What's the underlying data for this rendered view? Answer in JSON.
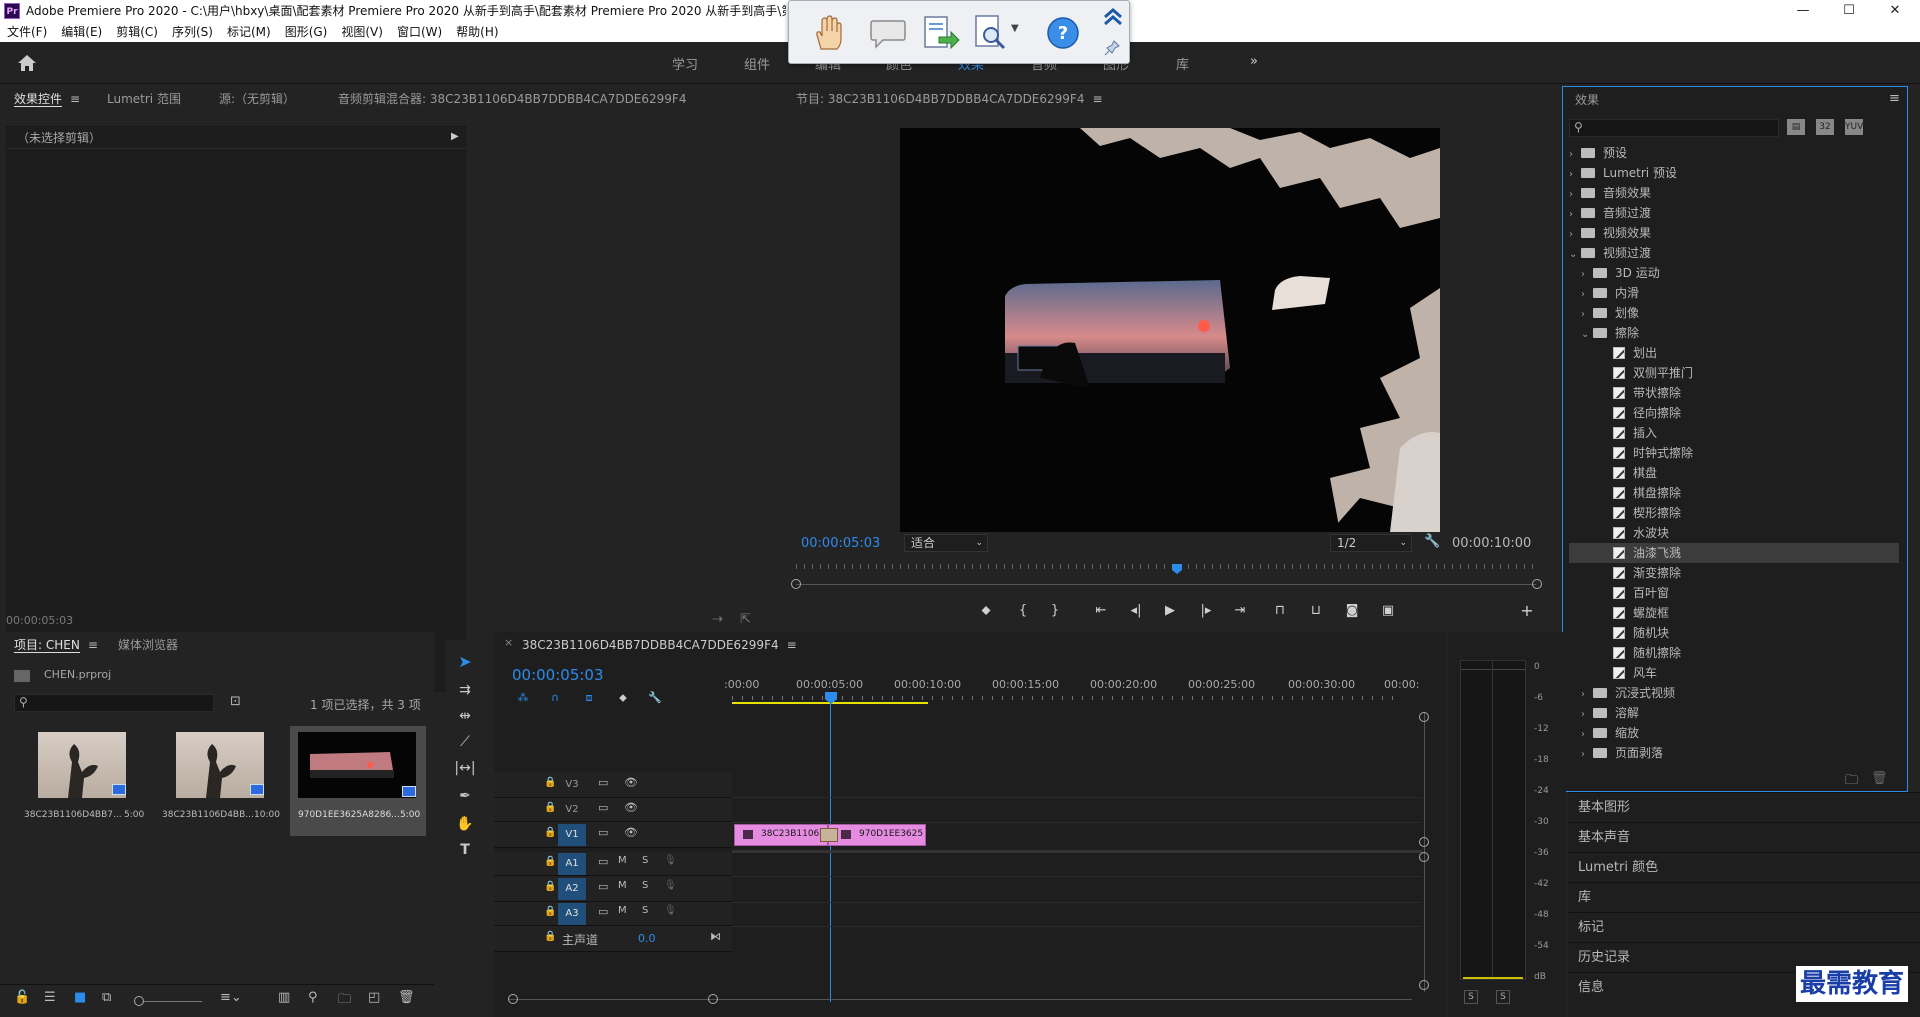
{
  "app": {
    "title": "Adobe Premiere Pro 2020 - C:\\用户\\hbxy\\桌面\\配套素材 Premiere Pro 2020 从新手到高手\\配套素材 Premiere Pro 2020 从新手到高手\\第",
    "icon": "Pr"
  },
  "window_controls": {
    "minimize": "—",
    "maximize": "☐",
    "close": "✕"
  },
  "menu": [
    "文件(F)",
    "编辑(E)",
    "剪辑(C)",
    "序列(S)",
    "标记(M)",
    "图形(G)",
    "视图(V)",
    "窗口(W)",
    "帮助(H)"
  ],
  "workspace_tabs": [
    "学习",
    "组件",
    "编辑",
    "颜色",
    "效果",
    "音频",
    "图形",
    "库"
  ],
  "workspace_more": "»",
  "top_left_tabs": {
    "effect_controls": "效果控件",
    "lumetri_scopes": "Lumetri 范围",
    "source": "源:（无剪辑）",
    "audio_mixer": "音频剪辑混合器: 38C23B1106D4BB7DDBB4CA7DDE6299F4"
  },
  "effect_controls": {
    "no_clip": "（未选择剪辑）",
    "timecode": "00:00:05:03"
  },
  "program": {
    "title": "节目: 38C23B1106D4BB7DDBB4CA7DDE6299F4",
    "timecode": "00:00:05:03",
    "fit": "适合",
    "resolution": "1/2",
    "duration": "00:00:10:00"
  },
  "project": {
    "tab": "项目: CHEN",
    "media_tab": "媒体浏览器",
    "file": "CHEN.prproj",
    "selection": "1 项已选择，共 3 项",
    "items": [
      {
        "name": "38C23B1106D4BB7...",
        "dur": "5:00"
      },
      {
        "name": "38C23B1106D4BB...",
        "dur": "10:00"
      },
      {
        "name": "970D1EE3625A8286...",
        "dur": "5:00"
      }
    ]
  },
  "timeline": {
    "tab": "38C23B1106D4BB7DDBB4CA7DDE6299F4",
    "timecode": "00:00:05:03",
    "ruler": [
      ":00:00",
      "00:00:05:00",
      "00:00:10:00",
      "00:00:15:00",
      "00:00:20:00",
      "00:00:25:00",
      "00:00:30:00",
      "00:00:"
    ],
    "video_tracks": [
      "V3",
      "V2",
      "V1"
    ],
    "audio_tracks": [
      "A1",
      "A2",
      "A3"
    ],
    "mute": "M",
    "solo": "S",
    "master": {
      "label": "主声道",
      "value": "0.0"
    },
    "clips": [
      "38C23B1106",
      "970D1EE3625"
    ]
  },
  "meter": {
    "labels": [
      "0",
      "-6",
      "-12",
      "-18",
      "-24",
      "-30",
      "-36",
      "-42",
      "-48",
      "-54",
      "dB"
    ],
    "solo": [
      "S",
      "S"
    ]
  },
  "effects": {
    "title": "效果",
    "tree": [
      {
        "label": "预设",
        "level": 0,
        "type": "folder",
        "open": false
      },
      {
        "label": "Lumetri 预设",
        "level": 0,
        "type": "folder",
        "open": false
      },
      {
        "label": "音频效果",
        "level": 0,
        "type": "folder",
        "open": false
      },
      {
        "label": "音频过渡",
        "level": 0,
        "type": "folder",
        "open": false
      },
      {
        "label": "视频效果",
        "level": 0,
        "type": "folder",
        "open": false
      },
      {
        "label": "视频过渡",
        "level": 0,
        "type": "folder",
        "open": true
      },
      {
        "label": "3D 运动",
        "level": 1,
        "type": "folder",
        "open": false
      },
      {
        "label": "内滑",
        "level": 1,
        "type": "folder",
        "open": false
      },
      {
        "label": "划像",
        "level": 1,
        "type": "folder",
        "open": false
      },
      {
        "label": "擦除",
        "level": 1,
        "type": "folder",
        "open": true
      },
      {
        "label": "划出",
        "level": 2,
        "type": "effect"
      },
      {
        "label": "双侧平推门",
        "level": 2,
        "type": "effect"
      },
      {
        "label": "带状擦除",
        "level": 2,
        "type": "effect"
      },
      {
        "label": "径向擦除",
        "level": 2,
        "type": "effect"
      },
      {
        "label": "插入",
        "level": 2,
        "type": "effect"
      },
      {
        "label": "时钟式擦除",
        "level": 2,
        "type": "effect"
      },
      {
        "label": "棋盘",
        "level": 2,
        "type": "effect"
      },
      {
        "label": "棋盘擦除",
        "level": 2,
        "type": "effect"
      },
      {
        "label": "楔形擦除",
        "level": 2,
        "type": "effect"
      },
      {
        "label": "水波块",
        "level": 2,
        "type": "effect"
      },
      {
        "label": "油漆飞溅",
        "level": 2,
        "type": "effect",
        "selected": true
      },
      {
        "label": "渐变擦除",
        "level": 2,
        "type": "effect"
      },
      {
        "label": "百叶窗",
        "level": 2,
        "type": "effect"
      },
      {
        "label": "螺旋框",
        "level": 2,
        "type": "effect"
      },
      {
        "label": "随机块",
        "level": 2,
        "type": "effect"
      },
      {
        "label": "随机擦除",
        "level": 2,
        "type": "effect"
      },
      {
        "label": "风车",
        "level": 2,
        "type": "effect"
      },
      {
        "label": "沉浸式视频",
        "level": 1,
        "type": "folder",
        "open": false
      },
      {
        "label": "溶解",
        "level": 1,
        "type": "folder",
        "open": false
      },
      {
        "label": "缩放",
        "level": 1,
        "type": "folder",
        "open": false
      },
      {
        "label": "页面剥落",
        "level": 1,
        "type": "folder",
        "open": false
      }
    ]
  },
  "right_panels": [
    "基本图形",
    "基本声音",
    "Lumetri 颜色",
    "库",
    "标记",
    "历史记录",
    "信息"
  ],
  "watermark": "最需教育",
  "colors": {
    "accent": "#2d8ceb",
    "clip": "#e58be0",
    "panel_border": "#2d8ceb",
    "playhead": "#2d8ceb"
  }
}
